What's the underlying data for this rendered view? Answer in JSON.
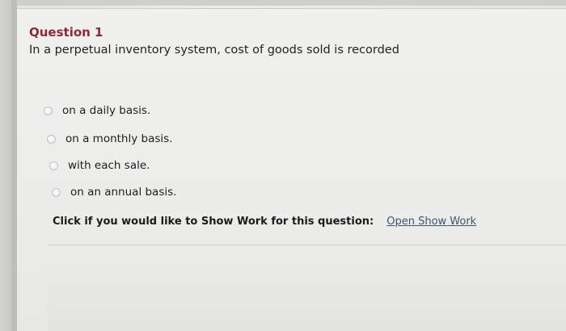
{
  "question": {
    "title": "Question 1",
    "text": "In a perpetual inventory system, cost of goods sold is recorded",
    "options": [
      {
        "label": "on a daily basis.",
        "selected": false
      },
      {
        "label": "on a monthly basis.",
        "selected": false
      },
      {
        "label": "with each sale.",
        "selected": false
      },
      {
        "label": "on an annual basis.",
        "selected": false
      }
    ]
  },
  "show_work": {
    "prompt": "Click if you would like to Show Work for this question:",
    "link_label": "Open Show Work"
  },
  "colors": {
    "title": "#8a2b35",
    "link": "#3f5572",
    "background": "#ececea"
  }
}
